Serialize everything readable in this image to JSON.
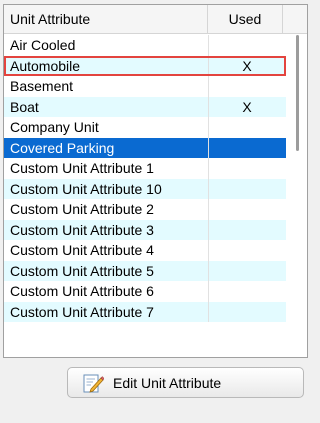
{
  "table": {
    "columns": {
      "attribute": "Unit Attribute",
      "used": "Used"
    },
    "rows": [
      {
        "attribute": "Air Cooled",
        "used": ""
      },
      {
        "attribute": "Automobile",
        "used": "X"
      },
      {
        "attribute": "Basement",
        "used": ""
      },
      {
        "attribute": "Boat",
        "used": "X"
      },
      {
        "attribute": "Company Unit",
        "used": ""
      },
      {
        "attribute": "Covered Parking",
        "used": ""
      },
      {
        "attribute": "Custom Unit Attribute 1",
        "used": ""
      },
      {
        "attribute": "Custom Unit Attribute 10",
        "used": ""
      },
      {
        "attribute": "Custom Unit Attribute 2",
        "used": ""
      },
      {
        "attribute": "Custom Unit Attribute 3",
        "used": ""
      },
      {
        "attribute": "Custom Unit Attribute 4",
        "used": ""
      },
      {
        "attribute": "Custom Unit Attribute 5",
        "used": ""
      },
      {
        "attribute": "Custom Unit Attribute 6",
        "used": ""
      },
      {
        "attribute": "Custom Unit Attribute 7",
        "used": ""
      }
    ],
    "selected_row": "Covered Parking",
    "highlighted_row": "Automobile"
  },
  "edit_button": {
    "label": "Edit Unit Attribute",
    "icon": "edit-icon"
  },
  "colors": {
    "selected": "#0a6ad1",
    "alt_row": "#e3fbff",
    "highlight": "#e3443f"
  }
}
